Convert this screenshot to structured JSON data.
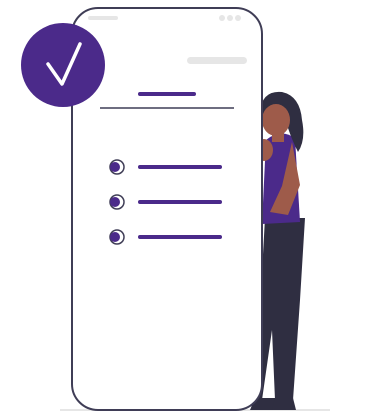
{
  "illustration": {
    "subject": "person-beside-phone-checklist",
    "icons": [
      "check-icon",
      "bullet-icon"
    ],
    "colors": {
      "accent": "#4b2a8a",
      "accent_light": "#5a33a3",
      "outline": "#3f3d56",
      "skin": "#9e5b4a",
      "hair": "#2f2e41",
      "pants": "#2f2e41",
      "placeholder": "#e6e6e6",
      "background": "#ffffff"
    },
    "checklist": {
      "item_count": 3
    }
  }
}
